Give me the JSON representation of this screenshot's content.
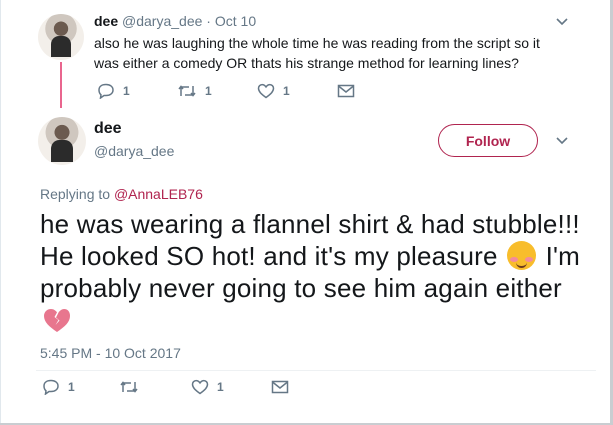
{
  "colors": {
    "accent": "#b0244f",
    "thread": "#e0245e",
    "muted": "#657786"
  },
  "parent_tweet": {
    "name": "dee",
    "handle": "@darya_dee",
    "separator": "·",
    "date": "Oct 10",
    "text": "also he was laughing the whole time he was reading from the script so it was either a comedy OR thats his strange method for learning lines?",
    "reply_count": "1",
    "retweet_count": "1",
    "like_count": "1"
  },
  "main_tweet": {
    "name": "dee",
    "handle": "@darya_dee",
    "follow_label": "Follow",
    "replying_prefix": "Replying to",
    "replying_to": "@AnnaLEB76",
    "text_part1": "he was wearing a flannel shirt & had stubble!!! He looked SO hot! and it's my pleasure",
    "text_part2": "I'm probably never going to see him again either",
    "timestamp": "5:45 PM - 10 Oct 2017",
    "reply_count": "1",
    "like_count": "1",
    "emoji1": "smiling-face-with-blush",
    "emoji2": "broken-heart"
  },
  "icons": [
    "reply-icon",
    "retweet-icon",
    "like-icon",
    "message-icon",
    "chevron-down-icon"
  ]
}
